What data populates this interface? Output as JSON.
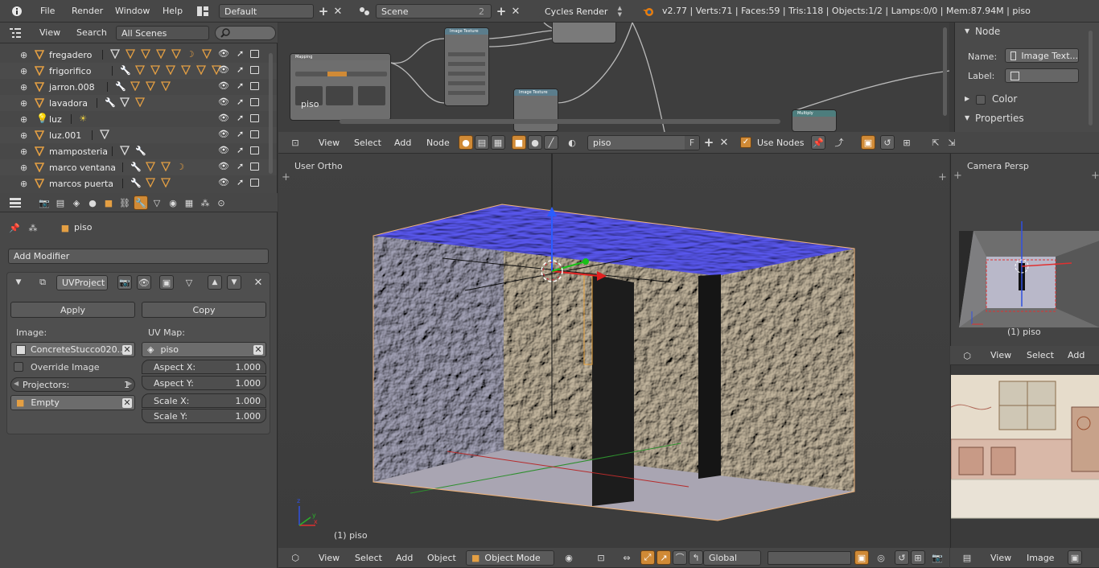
{
  "topbar": {
    "menus": [
      "File",
      "Render",
      "Window",
      "Help"
    ],
    "screen_layout": "Default",
    "scene": "Scene",
    "scene_users": "2",
    "render_engine": "Cycles Render",
    "stats": "v2.77 | Verts:71 | Faces:59 | Tris:118 | Objects:1/2 | Lamps:0/0 | Mem:87.94M | piso"
  },
  "outliner": {
    "view_label": "View",
    "search_label": "Search",
    "scope": "All Scenes",
    "items": [
      {
        "name": "fregadero"
      },
      {
        "name": "frigorifico"
      },
      {
        "name": "jarron.008"
      },
      {
        "name": "lavadora"
      },
      {
        "name": "luz"
      },
      {
        "name": "luz.001"
      },
      {
        "name": "mamposteria"
      },
      {
        "name": "marco ventana"
      },
      {
        "name": "marcos puerta"
      }
    ]
  },
  "properties": {
    "object_name": "piso",
    "add_modifier": "Add Modifier",
    "modifier_name": "UVProject",
    "apply": "Apply",
    "copy": "Copy",
    "image_label": "Image:",
    "image_value": "ConcreteStucco020...",
    "uvmap_label": "UV Map:",
    "uvmap_value": "piso",
    "override_image": "Override Image",
    "projectors_label": "Projectors:",
    "projectors_value": "1",
    "empty_value": "Empty",
    "aspect_x_label": "Aspect X:",
    "aspect_x": "1.000",
    "aspect_y_label": "Aspect Y:",
    "aspect_y": "1.000",
    "scale_x_label": "Scale X:",
    "scale_x": "1.000",
    "scale_y_label": "Scale Y:",
    "scale_y": "1.000"
  },
  "node_editor": {
    "menus": [
      "View",
      "Select",
      "Add",
      "Node"
    ],
    "material": "piso",
    "fake_user": "F",
    "use_nodes": "Use Nodes",
    "nodes": {
      "mapping": "Mapping",
      "image_texture_1": "Image Texture",
      "image_texture_2": "Image Texture",
      "multiply": "Multiply"
    },
    "frame_label": "piso"
  },
  "node_sidebar": {
    "node_header": "Node",
    "name_label": "Name:",
    "name_value": "Image Text...",
    "label_label": "Label:",
    "color_header": "Color",
    "properties_header": "Properties"
  },
  "viewport": {
    "view_name": "User Ortho",
    "object_info": "(1) piso",
    "menus": [
      "View",
      "Select",
      "Add",
      "Object"
    ],
    "mode": "Object Mode",
    "orientation": "Global"
  },
  "camera_view": {
    "view_name": "Camera Persp",
    "object_info": "(1) piso",
    "menus": [
      "View",
      "Select",
      "Add"
    ]
  },
  "image_editor": {
    "menus": [
      "View",
      "Image"
    ]
  }
}
